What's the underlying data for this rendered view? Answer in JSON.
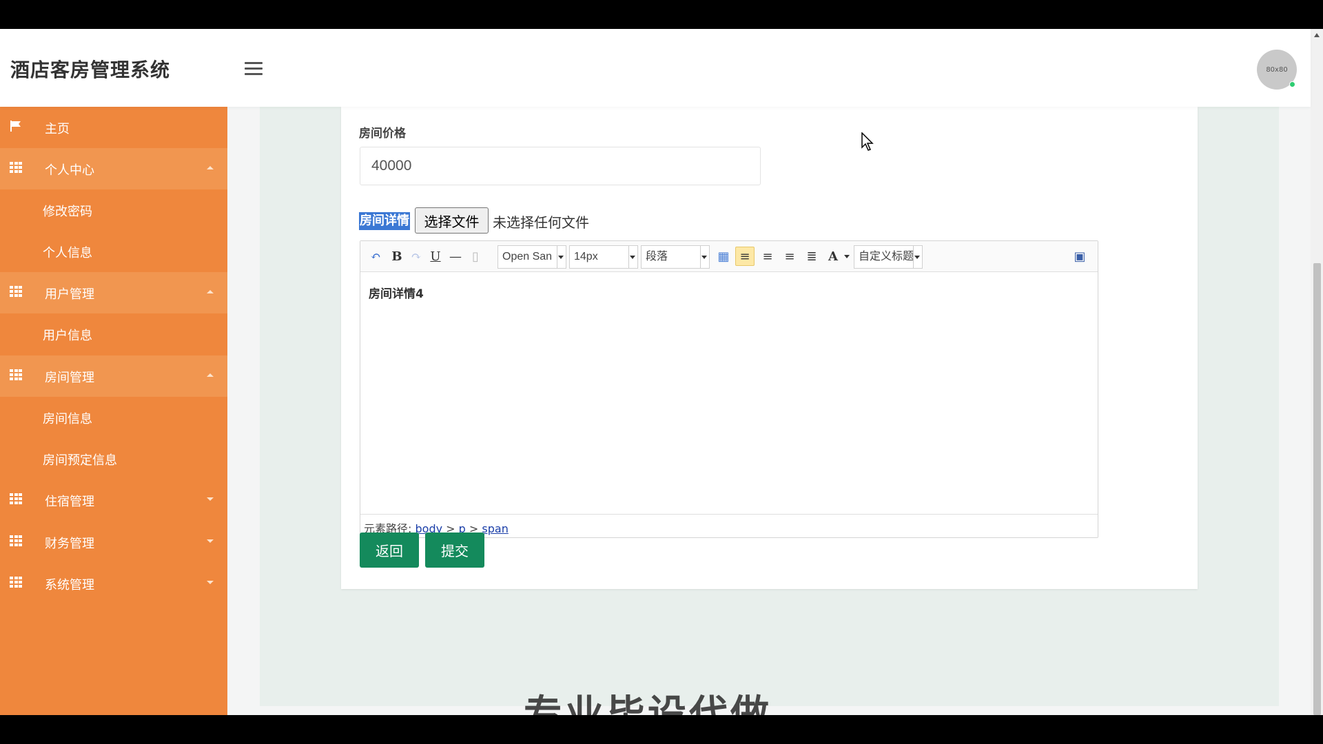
{
  "header": {
    "title": "酒店客房管理系统",
    "avatar_text": "80x80"
  },
  "sidebar": {
    "home": "主页",
    "personal_center": "个人中心",
    "change_password": "修改密码",
    "personal_info": "个人信息",
    "user_mgmt": "用户管理",
    "user_info": "用户信息",
    "room_mgmt": "房间管理",
    "room_info": "房间信息",
    "room_booking": "房间预定信息",
    "lodging_mgmt": "住宿管理",
    "finance_mgmt": "财务管理",
    "system_mgmt": "系统管理"
  },
  "form": {
    "price_label": "房间价格",
    "price_value": "40000",
    "detail_label": "房间详情",
    "file_button": "选择文件",
    "file_status": "未选择任何文件"
  },
  "editor": {
    "toolbar": {
      "font": "Open San",
      "size": "14px",
      "paragraph": "段落",
      "custom_heading": "自定义标题"
    },
    "content": "房间详情4",
    "path_label": "元素路径:",
    "path": [
      "body",
      "p",
      "span"
    ]
  },
  "buttons": {
    "back": "返回",
    "submit": "提交"
  },
  "watermark": "专业毕设代做"
}
